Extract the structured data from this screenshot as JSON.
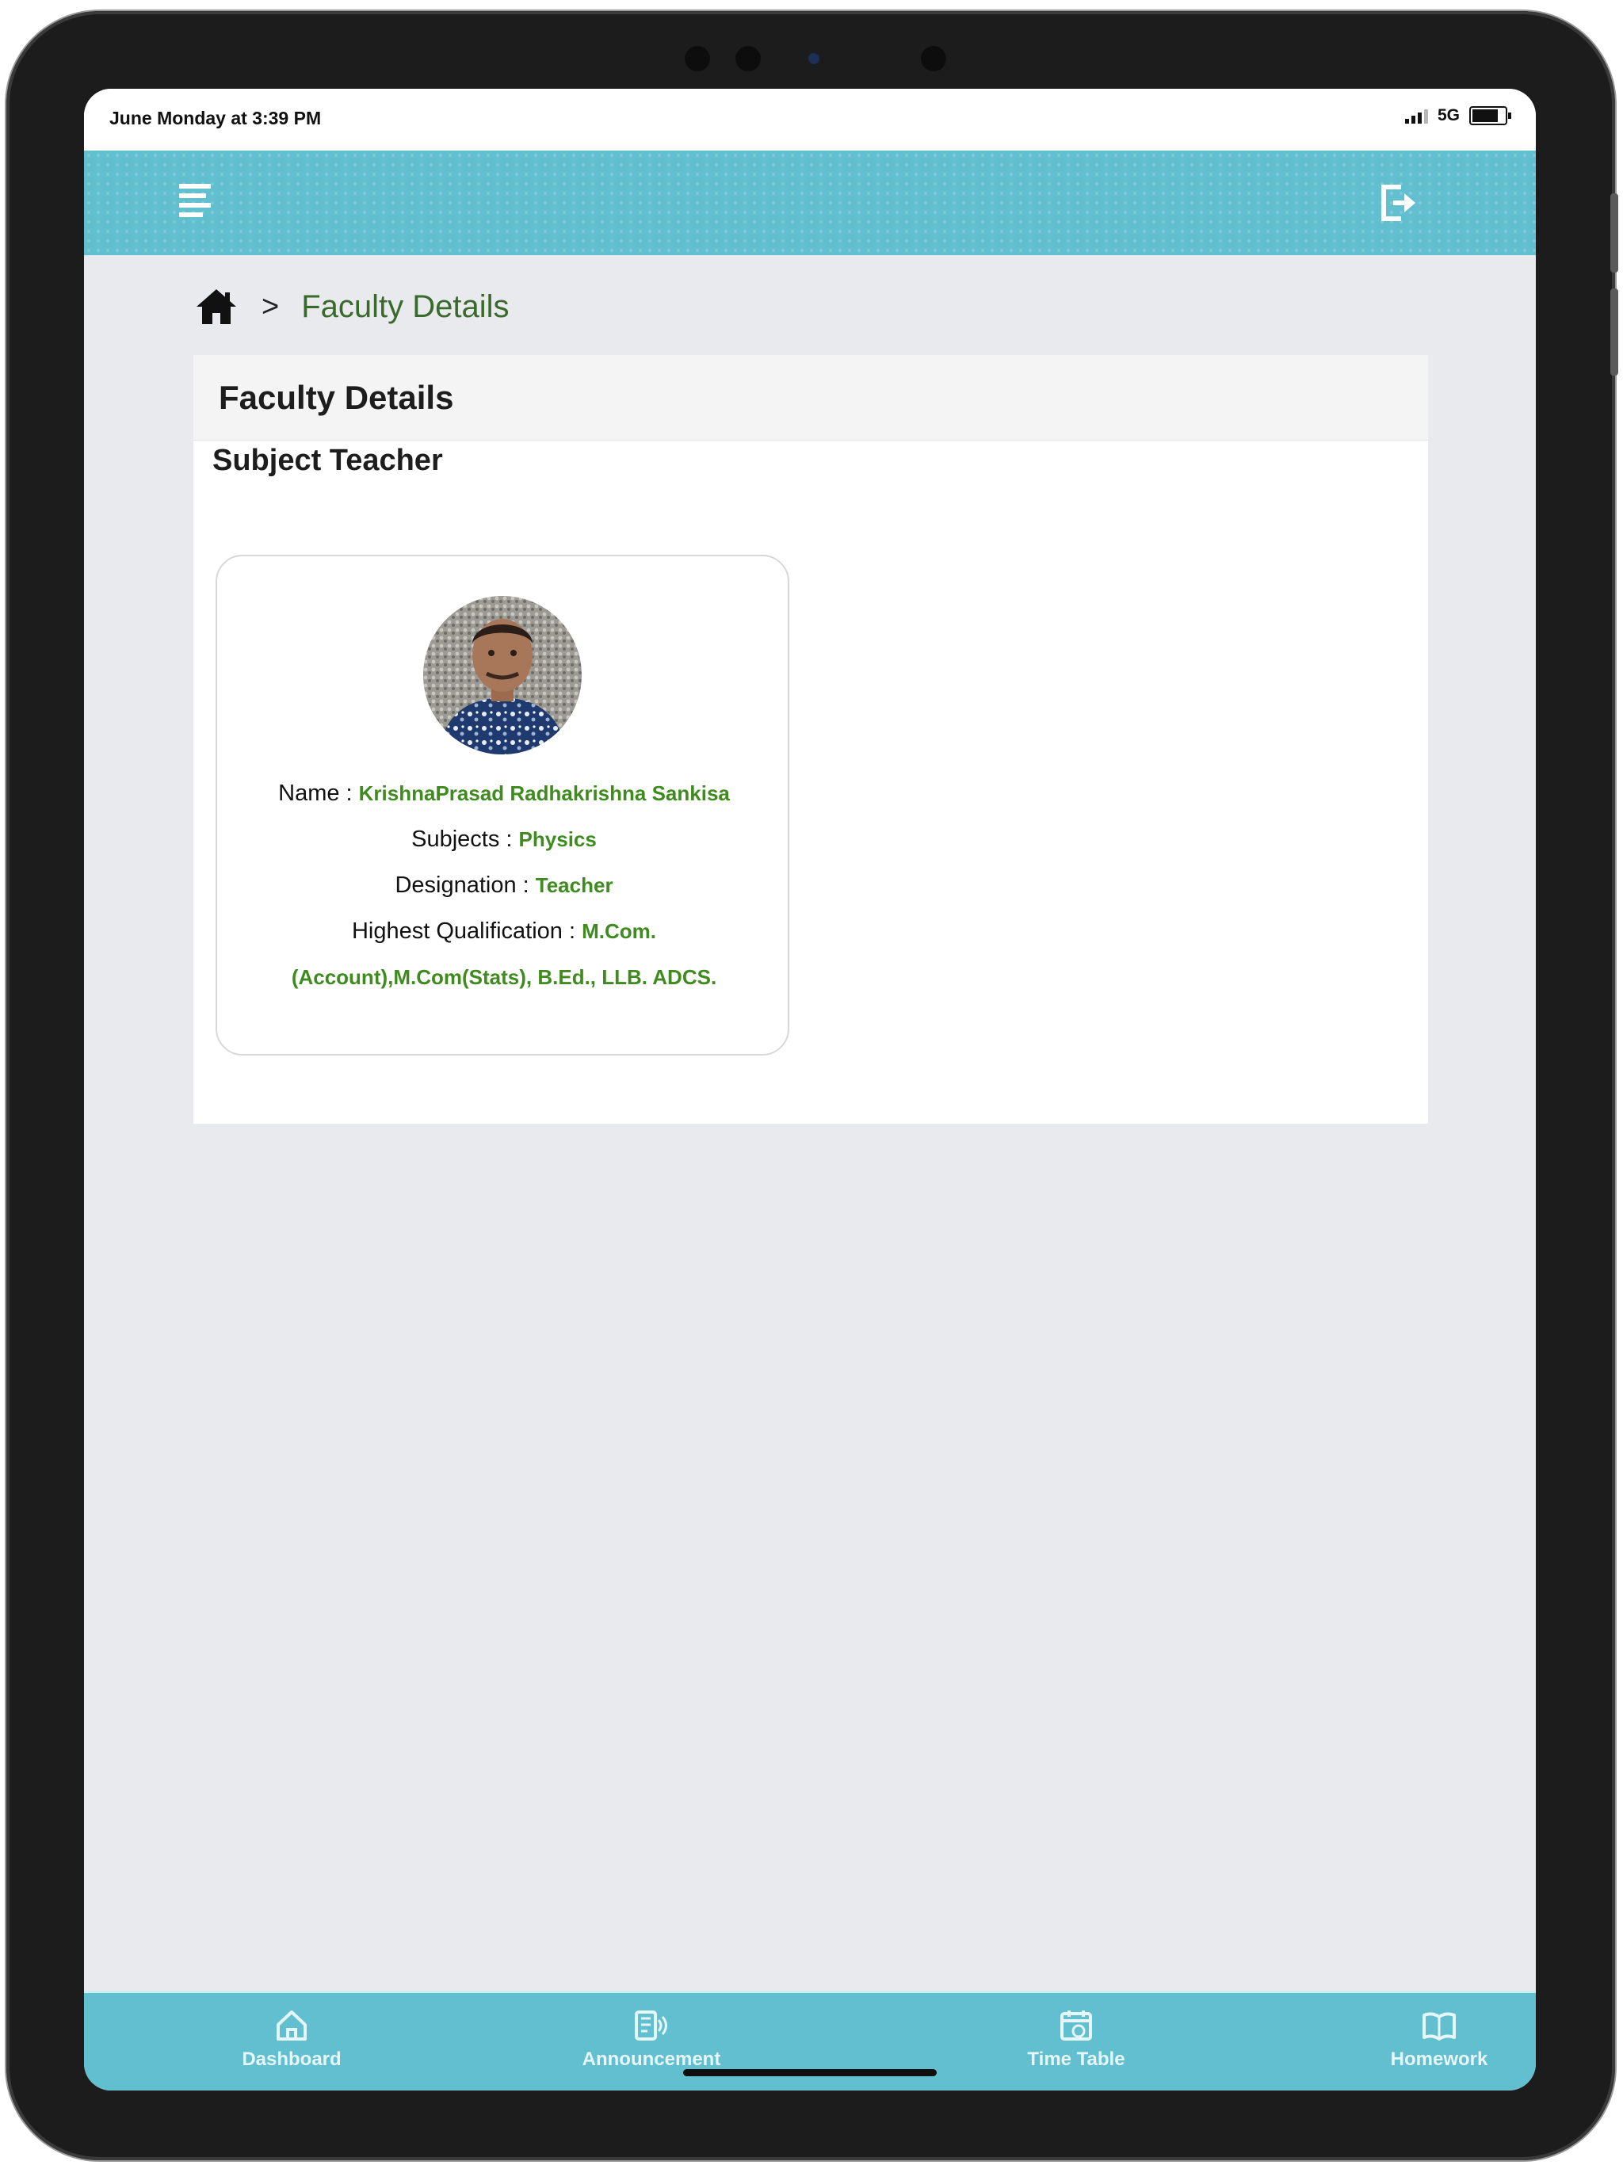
{
  "status_bar": {
    "time": "June Monday at 3:39 PM",
    "network": "5G"
  },
  "header": {
    "menu_icon": "hamburger-menu-icon",
    "logout_icon": "logout-icon"
  },
  "breadcrumb": {
    "home_icon": "home-icon",
    "separator": ">",
    "current": "Faculty Details"
  },
  "panel": {
    "title": "Faculty Details",
    "section_title": "Subject Teacher"
  },
  "faculty": {
    "name_label": "Name : ",
    "name": "KrishnaPrasad Radhakrishna Sankisa",
    "subjects_label": "Subjects : ",
    "subjects": "Physics",
    "designation_label": "Designation : ",
    "designation": "Teacher",
    "qualification_label": "Highest Qualification : ",
    "qualification_line1": "M.Com.",
    "qualification_line2": "(Account),M.Com(Stats), B.Ed., LLB. ADCS."
  },
  "bottom_nav": [
    {
      "label": "Dashboard",
      "icon": "dashboard-home-icon"
    },
    {
      "label": "Announcement",
      "icon": "announcement-icon"
    },
    {
      "label": "Time Table",
      "icon": "timetable-calendar-icon"
    },
    {
      "label": "Homework",
      "icon": "homework-book-icon"
    }
  ],
  "colors": {
    "header": "#62bfcf",
    "value_green": "#3f8b1f",
    "page_bg": "#e9eaee"
  }
}
